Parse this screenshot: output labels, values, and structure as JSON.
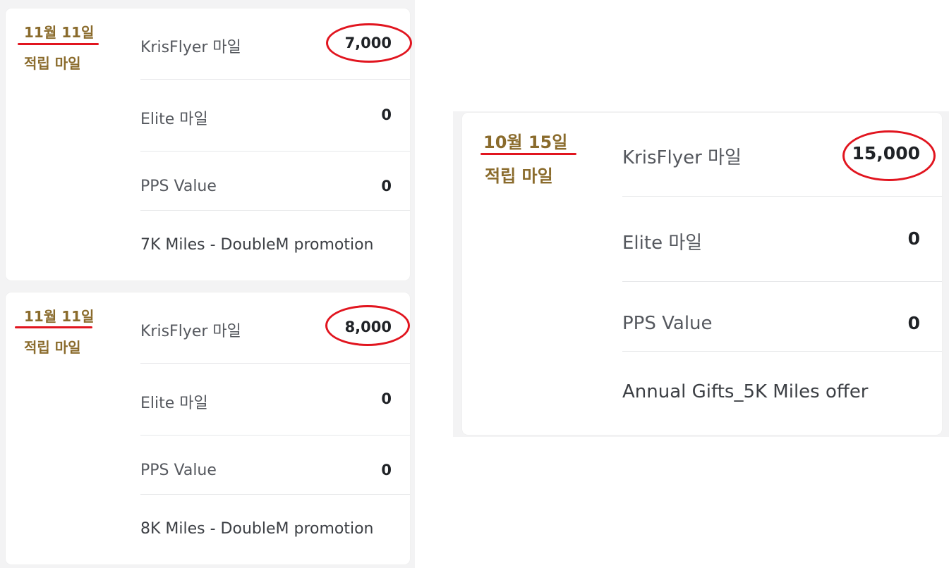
{
  "colors": {
    "annotation_text": "#8a6b2c",
    "annotation_red": "#e1151f",
    "card_bg": "#ffffff",
    "panel_bg": "#f3f3f4",
    "label": "#55585e",
    "value": "#1f2226",
    "divider": "#e6e7e9"
  },
  "cards": [
    {
      "annotation": {
        "date": "11월 11일",
        "caption": "적립 마일"
      },
      "rows": [
        {
          "label": "KrisFlyer 마일",
          "value": "7,000"
        },
        {
          "label": "Elite 마일",
          "value": "0"
        },
        {
          "label": "PPS Value",
          "value": "0"
        }
      ],
      "description": "7K Miles - DoubleM promotion"
    },
    {
      "annotation": {
        "date": "11월 11일",
        "caption": "적립 마일"
      },
      "rows": [
        {
          "label": "KrisFlyer 마일",
          "value": "8,000"
        },
        {
          "label": "Elite 마일",
          "value": "0"
        },
        {
          "label": "PPS Value",
          "value": "0"
        }
      ],
      "description": "8K Miles - DoubleM promotion"
    },
    {
      "annotation": {
        "date": "10월 15일",
        "caption": "적립 마일"
      },
      "rows": [
        {
          "label": "KrisFlyer 마일",
          "value": "15,000"
        },
        {
          "label": "Elite 마일",
          "value": "0"
        },
        {
          "label": "PPS Value",
          "value": "0"
        }
      ],
      "description": "Annual Gifts_5K Miles offer"
    }
  ]
}
